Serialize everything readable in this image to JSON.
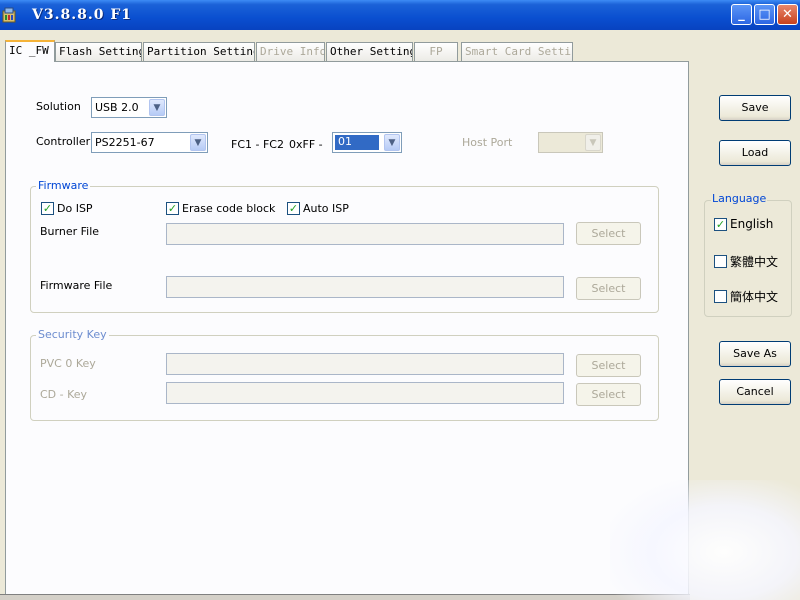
{
  "window": {
    "title": "V3.8.8.0 F1",
    "minimize_glyph": "_",
    "maximize_glyph": "□",
    "close_glyph": "✕"
  },
  "tabs": [
    {
      "label": "IC _FW",
      "state": "active"
    },
    {
      "label": "Flash Setting",
      "state": "enabled"
    },
    {
      "label": "Partition Setting",
      "state": "enabled"
    },
    {
      "label": "Drive Info",
      "state": "disabled"
    },
    {
      "label": "Other Setting",
      "state": "enabled"
    },
    {
      "label": "FP",
      "state": "disabled"
    },
    {
      "label": "Smart Card Setting",
      "state": "disabled"
    }
  ],
  "ic_fw": {
    "solution_label": "Solution",
    "solution_value": "USB 2.0",
    "controller_label": "Controller",
    "controller_value": "PS2251-67",
    "fc_label": "FC1 - FC2",
    "fc_prefix": "0xFF -",
    "fc_value": "01",
    "host_port_label": "Host Port",
    "host_port_value": "",
    "firmware": {
      "title": "Firmware",
      "do_isp_label": "Do ISP",
      "do_isp_checked": true,
      "erase_code_block_label": "Erase code block",
      "erase_code_block_checked": true,
      "auto_isp_label": "Auto ISP",
      "auto_isp_checked": true,
      "burner_file_label": "Burner File",
      "burner_file_value": "",
      "firmware_file_label": "Firmware File",
      "firmware_file_value": "",
      "select_label": "Select"
    },
    "security_key": {
      "title": "Security Key",
      "pvc0_label": "PVC 0 Key",
      "cd_label": "CD - Key",
      "select_label": "Select"
    }
  },
  "actions": {
    "save": "Save",
    "load": "Load",
    "save_as": "Save As",
    "cancel": "Cancel"
  },
  "language": {
    "title": "Language",
    "options": [
      {
        "label": "English",
        "checked": true
      },
      {
        "label": "繁體中文",
        "checked": false
      },
      {
        "label": "簡体中文",
        "checked": false
      }
    ]
  },
  "checkmark": "✓",
  "combo_arrow": "▼"
}
